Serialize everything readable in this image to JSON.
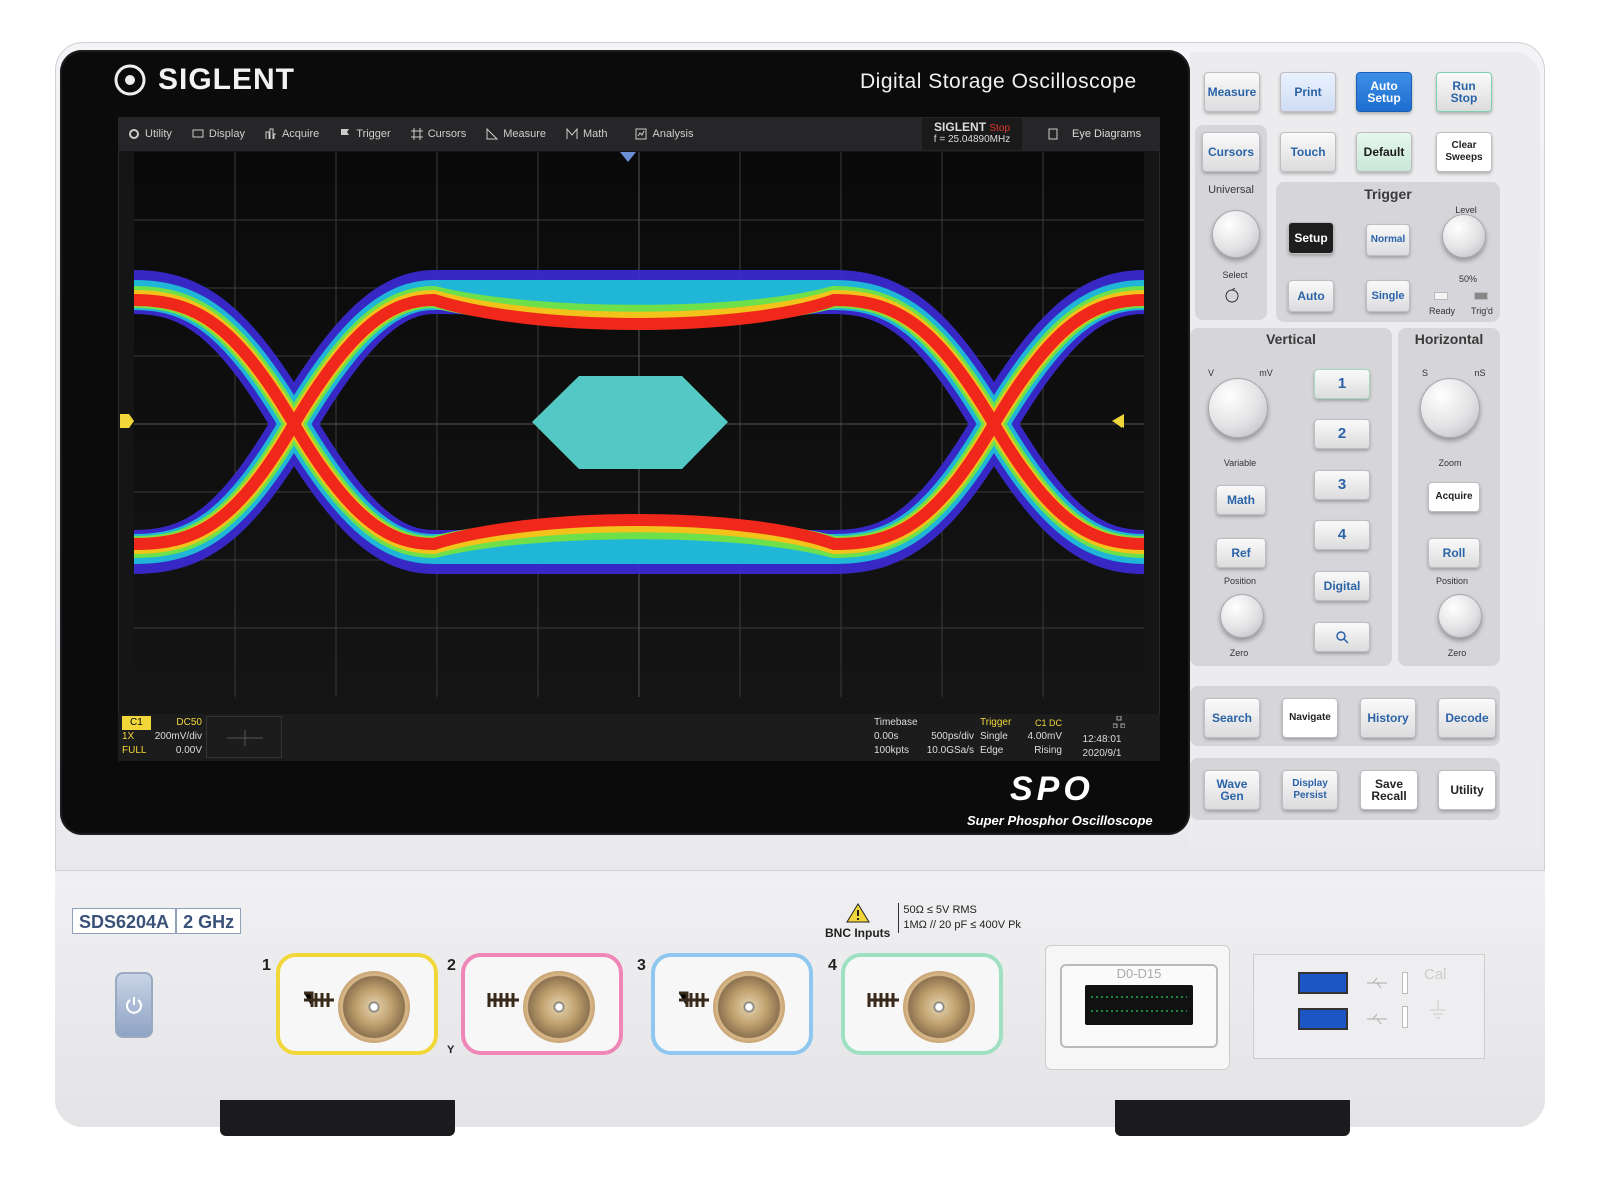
{
  "brand": {
    "logo_text": "SIGLENT",
    "product_title": "Digital Storage Oscilloscope"
  },
  "menu": {
    "items": [
      {
        "label": "Utility",
        "icon": "gear-icon"
      },
      {
        "label": "Display",
        "icon": "monitor-icon"
      },
      {
        "label": "Acquire",
        "icon": "acquire-icon"
      },
      {
        "label": "Trigger",
        "icon": "flag-icon"
      },
      {
        "label": "Cursors",
        "icon": "cursor-icon"
      },
      {
        "label": "Measure",
        "icon": "ruler-icon"
      },
      {
        "label": "Math",
        "icon": "math-icon"
      },
      {
        "label": "Analysis",
        "icon": "analysis-icon"
      }
    ],
    "run_state_brand": "SIGLENT",
    "run_state": "Stop",
    "frequency": "f = 25.04890MHz",
    "eye_diagrams": "Eye Diagrams"
  },
  "status": {
    "channel": "C1",
    "coupling": "DC50",
    "probe": "1X",
    "scale": "200mV/div",
    "bw": "FULL",
    "offset": "0.00V",
    "timebase_label": "Timebase",
    "delay": "0.00s",
    "time_scale": "500ps/div",
    "points": "100kpts",
    "sample_rate": "10.0GSa/s",
    "trigger_label": "Trigger",
    "trig_src": "C1 DC",
    "trig_mode": "Single",
    "trig_level": "4.00mV",
    "trig_type": "Edge",
    "trig_slope": "Rising",
    "time": "12:48:01",
    "date": "2020/9/1"
  },
  "spo": {
    "logo": "SPO",
    "subtitle": "Super Phosphor Oscilloscope"
  },
  "panel": {
    "measure": "Measure",
    "print": "Print",
    "auto_setup": "Auto\nSetup",
    "run_stop": "Run\nStop",
    "cursors": "Cursors",
    "touch": "Touch",
    "default": "Default",
    "clear_sweeps": "Clear\nSweeps",
    "universal": "Universal",
    "select": "Select",
    "trigger": "Trigger",
    "setup": "Setup",
    "normal": "Normal",
    "auto": "Auto",
    "single": "Single",
    "level": "Level",
    "fifty": "50%",
    "ready": "Ready",
    "trigd": "Trig'd",
    "vertical": "Vertical",
    "horizontal": "Horizontal",
    "ch1": "1",
    "ch2": "2",
    "ch3": "3",
    "ch4": "4",
    "digital": "Digital",
    "math": "Math",
    "ref": "Ref",
    "variable": "Variable",
    "position": "Position",
    "zero": "Zero",
    "acquire": "Acquire",
    "roll": "Roll",
    "zoom": "Zoom",
    "v": "V",
    "mv": "mV",
    "s": "S",
    "ns": "nS",
    "search": "Search",
    "navigate": "Navigate",
    "history": "History",
    "decode": "Decode",
    "wave_gen": "Wave\nGen",
    "display_persist": "Display\nPersist",
    "save_recall": "Save\nRecall",
    "utility": "Utility"
  },
  "front": {
    "model": "SDS6204A",
    "bandwidth": "2 GHz",
    "bnc_inputs": "BNC Inputs",
    "spec1": "50Ω ≤ 5V RMS",
    "spec2": "1MΩ // 20 pF ≤ 400V Pk",
    "ch_labels": [
      "1",
      "2",
      "3",
      "4"
    ],
    "y_label": "Y",
    "digital_label": "D0-D15",
    "cal": "Cal",
    "channel_colors": [
      "#f2d73a",
      "#ef86b8",
      "#8ec7ef",
      "#9fe0c0"
    ]
  }
}
